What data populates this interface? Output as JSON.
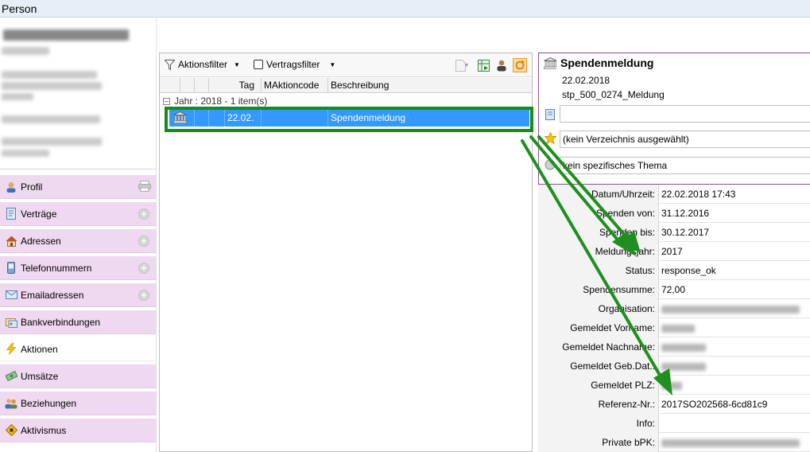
{
  "window": {
    "title": "Person"
  },
  "nav": [
    {
      "label": "Profil",
      "icon": "person-icon",
      "action": "print-icon"
    },
    {
      "label": "Verträge",
      "icon": "contract-icon",
      "action": "add-icon"
    },
    {
      "label": "Adressen",
      "icon": "house-icon",
      "action": "add-icon"
    },
    {
      "label": "Telefonnummern",
      "icon": "phone-icon",
      "action": "add-icon"
    },
    {
      "label": "Emailadressen",
      "icon": "mail-icon",
      "action": "add-icon"
    },
    {
      "label": "Bankverbindungen",
      "icon": "bank-card-icon",
      "action": ""
    },
    {
      "label": "Aktionen",
      "icon": "lightning-icon",
      "action": "",
      "active": true
    },
    {
      "label": "Umsätze",
      "icon": "money-icon",
      "action": ""
    },
    {
      "label": "Beziehungen",
      "icon": "people-icon",
      "action": ""
    },
    {
      "label": "Aktivismus",
      "icon": "warning-sign-icon",
      "action": ""
    }
  ],
  "toolbar": {
    "filter1": "Aktionsfilter",
    "filter2": "Vertragsfilter"
  },
  "columns": [
    "Tag",
    "MAktioncode",
    "Beschreibung"
  ],
  "group": {
    "label": "Jahr : 2018 - 1 item(s)"
  },
  "row": {
    "tag": "22.02.",
    "code": "",
    "beschreibung": "Spendenmeldung"
  },
  "detail": {
    "title": "Spendenmeldung",
    "date": "22.02.2018",
    "file": "stp_500_0274_Meldung",
    "field1": "",
    "verzeichnis": "(kein Verzeichnis ausgewählt)",
    "thema": "kein spezifisches Thema"
  },
  "properties": [
    {
      "key": "Datum/Uhrzeit:",
      "value": "22.02.2018 17:43"
    },
    {
      "key": "Spenden von:",
      "value": "31.12.2016"
    },
    {
      "key": "Spenden bis:",
      "value": "30.12.2017"
    },
    {
      "key": "Meldungsjahr:",
      "value": "2017"
    },
    {
      "key": "Status:",
      "value": "response_ok"
    },
    {
      "key": "Spendensumme:",
      "value": "72,00"
    },
    {
      "key": "Organisation:",
      "value": ""
    },
    {
      "key": "Gemeldet Vorname:",
      "value": ""
    },
    {
      "key": "Gemeldet Nachname:",
      "value": ""
    },
    {
      "key": "Gemeldet Geb.Dat.:",
      "value": ""
    },
    {
      "key": "Gemeldet PLZ:",
      "value": ""
    },
    {
      "key": "Referenz-Nr.:",
      "value": "2017SO202568-6cd81c9"
    },
    {
      "key": "Info:",
      "value": ""
    },
    {
      "key": "Private bPK:",
      "value": ""
    }
  ],
  "colors": {
    "selection": "#3399ff",
    "nav_bg": "#efd9f0",
    "highlight": "#1a8a1a",
    "detail_border": "#8e4f8e"
  }
}
